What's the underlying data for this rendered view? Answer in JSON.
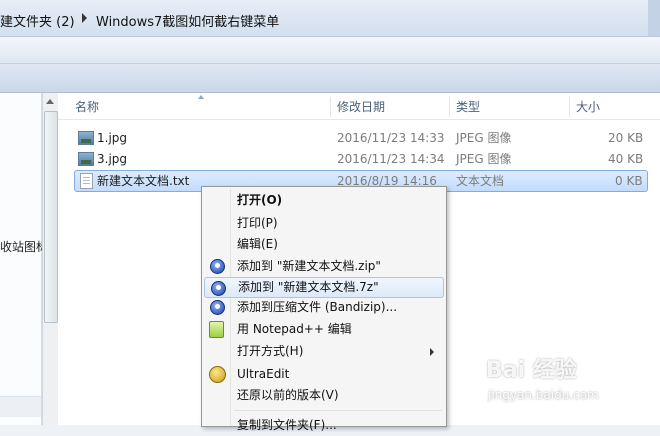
{
  "breadcrumb": {
    "items": [
      "建文件夹 (2)",
      "Windows7截图如何截右键菜单"
    ]
  },
  "nav_pane": {
    "partial_label": "收站图标"
  },
  "columns": [
    "名称",
    "修改日期",
    "类型",
    "大小"
  ],
  "files": [
    {
      "name": "1.jpg",
      "modified": "2016/11/23 14:33",
      "type": "JPEG 图像",
      "size": "20 KB",
      "icon": "image-file-icon"
    },
    {
      "name": "3.jpg",
      "modified": "2016/11/23 14:34",
      "type": "JPEG 图像",
      "size": "40 KB",
      "icon": "image-file-icon"
    },
    {
      "name": "新建文本文档.txt",
      "modified": "2016/8/19 14:16",
      "type": "文本文档",
      "size": "0 KB",
      "icon": "text-file-icon",
      "selected": true
    }
  ],
  "context_menu": {
    "items": [
      {
        "label": "打开(O)",
        "bold": true
      },
      {
        "label": "打印(P)"
      },
      {
        "label": "编辑(E)"
      },
      {
        "label": "添加到 \"新建文本文档.zip\"",
        "icon": "bandizip-icon"
      },
      {
        "label": "添加到 \"新建文本文档.7z\"",
        "icon": "bandizip-icon",
        "highlighted": true
      },
      {
        "label": "添加到压缩文件 (Bandizip)...",
        "icon": "bandizip-icon"
      },
      {
        "label": "用 Notepad++ 编辑",
        "icon": "notepad-plus-plus-icon"
      },
      {
        "label": "打开方式(H)",
        "submenu": true
      },
      {
        "label": "UltraEdit",
        "icon": "ultraedit-icon"
      },
      {
        "label": "还原以前的版本(V)"
      },
      {
        "label": "复制到文件夹(F)..."
      }
    ]
  },
  "watermark": {
    "logo": "Bai 经验",
    "url": "jingyan.baidu.com"
  },
  "colors": {
    "selection": "#cce0fb",
    "menu_bg": "#f5f5f5",
    "header_text": "#4c607a"
  }
}
